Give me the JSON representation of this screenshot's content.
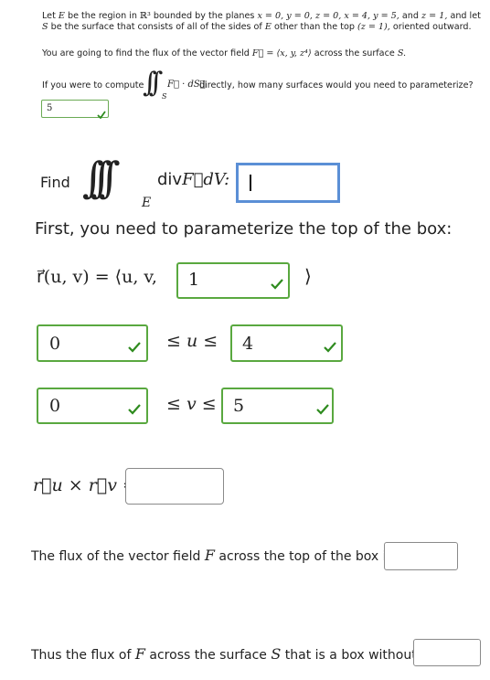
{
  "intro": {
    "line1_a": "Let",
    "line1_E": "E",
    "line1_b": "be the region in",
    "line1_R": "ℝ³",
    "line1_c": "bounded by the planes",
    "line1_planes": "x = 0, y = 0, z = 0, x = 4, y = 5,",
    "line1_and": "and",
    "line1_z1": "z = 1,",
    "line1_d": "and let",
    "line2_S": "S",
    "line2_a": "be the surface that consists of all of the sides of",
    "line2_E": "E",
    "line2_b": "other than the top",
    "line2_top": "(z = 1),",
    "line2_c": "oriented outward."
  },
  "goal": {
    "text_a": "You are going to find the flux of the vector field",
    "field": "F⃗ = ⟨x, y, z⁴⟩",
    "text_b": "across the surface",
    "S": "S."
  },
  "q1": {
    "text_a": "If you were to compute",
    "integral": "∫∫",
    "sub": "S",
    "integrand": "F⃗ · dS⃗",
    "text_b": "directly, how many surfaces would you need to parameterize?",
    "answer": "5"
  },
  "q2": {
    "find": "Find",
    "integral": "∫∫∫",
    "sub": "E",
    "integrand_a": "div",
    "integrand_F": "F⃗",
    "integrand_dv": "dV:",
    "answer": ""
  },
  "q3": {
    "heading": "First, you need to parameterize the top of the box:",
    "r_expr": "r⃗(u, v) = ⟨u, v,",
    "r_close": "⟩",
    "z_answer": "1",
    "u_lower": "0",
    "u_mid": "≤ u ≤",
    "u_upper": "4",
    "v_lower": "0",
    "v_mid": "≤ v ≤",
    "v_upper": "5",
    "cross": "r⃗u × r⃗v =",
    "cross_answer": ""
  },
  "q4": {
    "text_a": "The flux of the vector field",
    "F": "F",
    "text_b": "across the top of the box is",
    "answer": ""
  },
  "q5": {
    "text_a": "Thus the flux of",
    "F": "F",
    "text_b": "across the surface",
    "S": "S",
    "text_c": "that is a box without a top is",
    "answer": ""
  },
  "colors": {
    "correct_border": "#59a83f",
    "check_green": "#2e8b1e",
    "focus_blue": "#5b8fd6"
  },
  "icons": {
    "correct": "check-icon"
  }
}
